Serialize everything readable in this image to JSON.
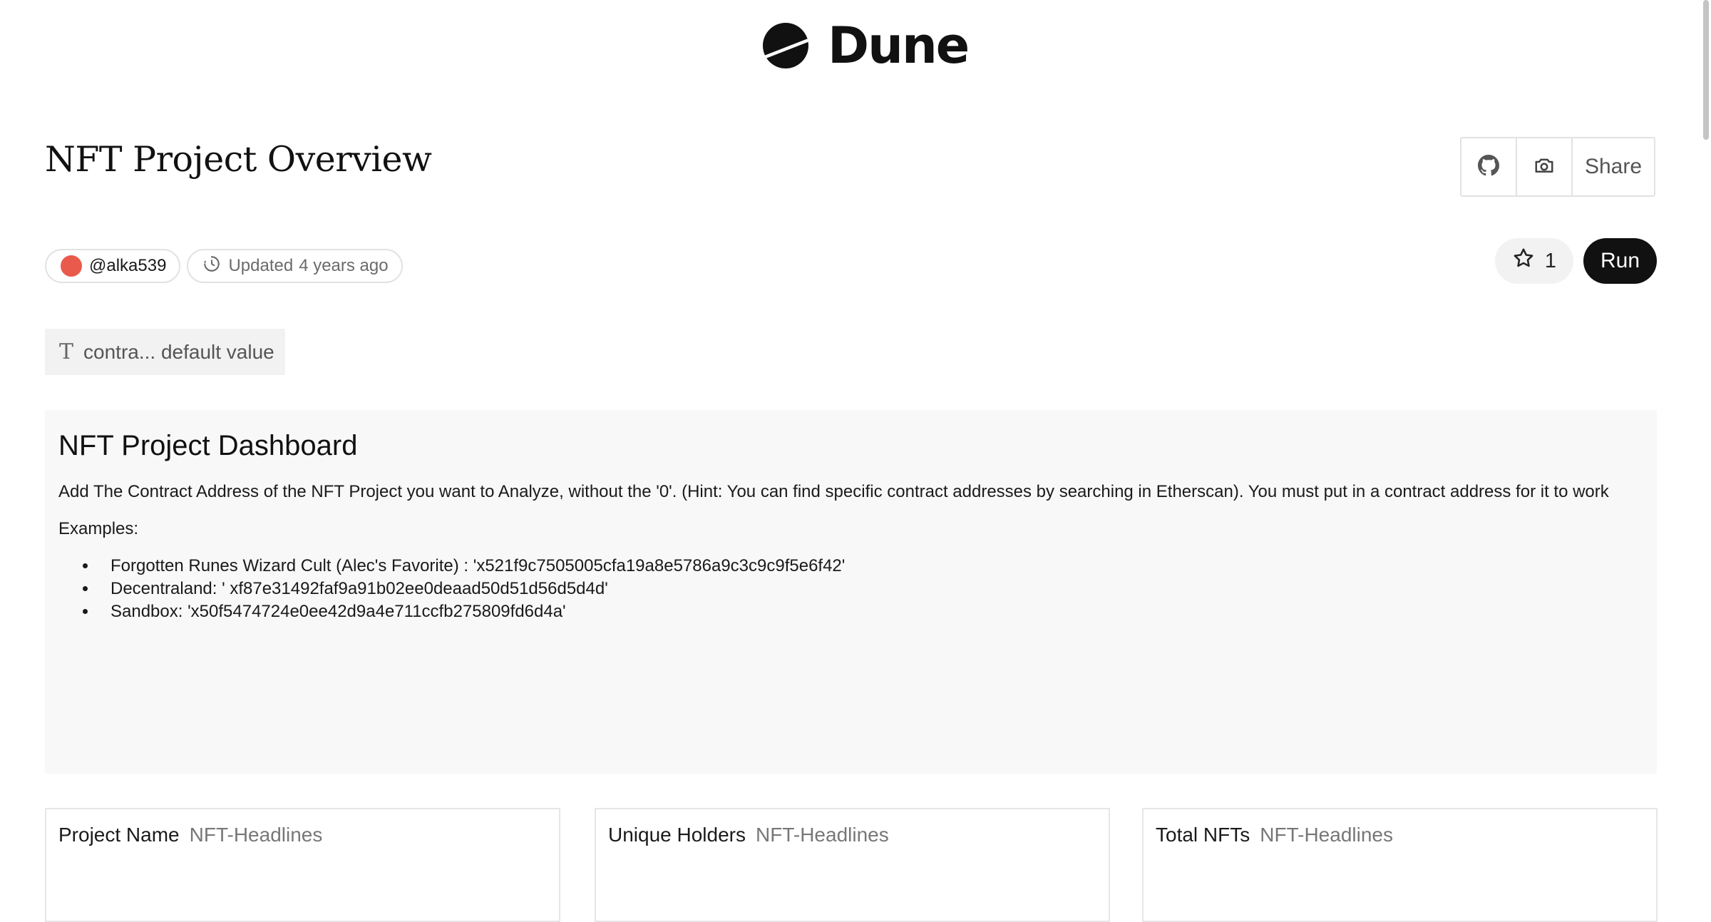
{
  "brand": {
    "name": "Dune"
  },
  "header": {
    "title": "NFT Project Overview",
    "actions": [
      {
        "icon": "github-icon"
      },
      {
        "icon": "camera-icon"
      },
      {
        "label": "Share"
      }
    ]
  },
  "meta": {
    "author": "@alka539",
    "updated_label": "Updated",
    "updated_value": "4 years ago"
  },
  "controls": {
    "star_count": "1",
    "run_label": "Run"
  },
  "parameter": {
    "icon": "text-type-icon",
    "value": "contra... default value"
  },
  "text_widget": {
    "heading": "NFT Project Dashboard",
    "paragraph": "Add The Contract Address of the NFT Project you want to Analyze, without the '0'. (Hint: You can find specific contract addresses by searching in Etherscan). You must put in a contract address for it to work",
    "examples_label": "Examples:",
    "examples": [
      "Forgotten Runes Wizard Cult (Alec's Favorite) : 'x521f9c7505005cfa19a8e5786a9c3c9c9f5e6f42'",
      "Decentraland: ' xf87e31492faf9a91b02ee0deaad50d51d56d5d4d'",
      "Sandbox: 'x50f5474724e0ee42d9a4e711ccfb275809fd6d4a'"
    ]
  },
  "cards": [
    {
      "label": "Project Name",
      "sub": "NFT-Headlines"
    },
    {
      "label": "Unique Holders",
      "sub": "NFT-Headlines"
    },
    {
      "label": "Total NFTs",
      "sub": "NFT-Headlines"
    }
  ],
  "colors": {
    "accent_dark": "#111111",
    "avatar": "#ea5a4c",
    "widget_bg": "#f8f8f8"
  }
}
